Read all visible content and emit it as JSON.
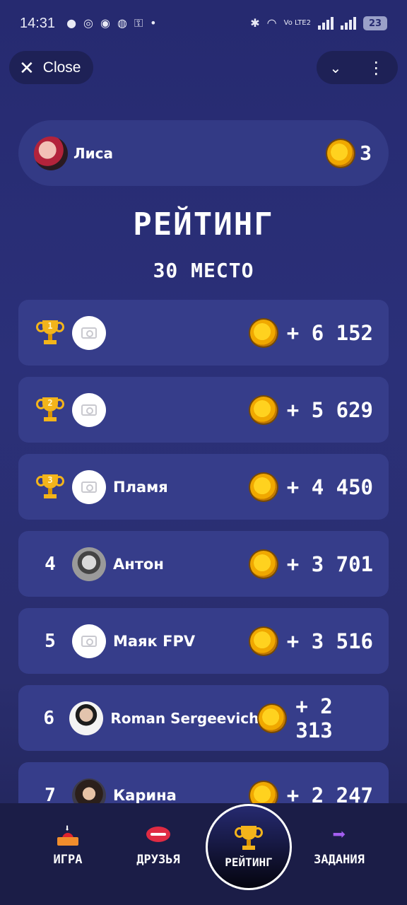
{
  "status_bar": {
    "time": "14:31",
    "battery": "23",
    "network": "Vo LTE2"
  },
  "top": {
    "close_label": "Close"
  },
  "user": {
    "name": "Лиса",
    "coins": "3"
  },
  "title": "РЕЙТИНГ",
  "place_label": "30 МЕСТО",
  "ranking": [
    {
      "rank": "1",
      "name": "",
      "score": "+ 6 152",
      "avatar": "placeholder"
    },
    {
      "rank": "2",
      "name": "",
      "score": "+ 5 629",
      "avatar": "placeholder"
    },
    {
      "rank": "3",
      "name": "Пламя",
      "score": "+ 4 450",
      "avatar": "placeholder"
    },
    {
      "rank": "4",
      "name": "Антон",
      "score": "+ 3 701",
      "avatar": "photo-glasses"
    },
    {
      "rank": "5",
      "name": "Маяк FPV",
      "score": "+ 3 516",
      "avatar": "placeholder"
    },
    {
      "rank": "6",
      "name": "Roman Sergeevich",
      "score": "+ 2 313",
      "avatar": "photo-man"
    },
    {
      "rank": "7",
      "name": "Карина",
      "score": "+ 2 247",
      "avatar": "photo-woman"
    }
  ],
  "nav": {
    "game": "ИГРА",
    "friends": "ДРУЗЬЯ",
    "rating": "РЕЙТИНГ",
    "tasks": "ЗАДАНИЯ"
  },
  "colors": {
    "background": "#2b3079",
    "card": "#363d8a",
    "coin": "#ffd21f",
    "trophy": "#f3b41b"
  }
}
